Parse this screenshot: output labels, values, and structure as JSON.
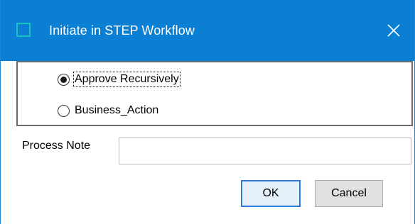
{
  "window": {
    "title": "Initiate in STEP Workflow",
    "title_bar_color": "#0b7fd4",
    "app_icon": "window-square-icon",
    "close_icon": "close-x-icon"
  },
  "radio_group": {
    "options": [
      {
        "label": "Approve Recursively",
        "selected": true
      },
      {
        "label": "Business_Action",
        "selected": false
      }
    ]
  },
  "process_note": {
    "label": "Process Note",
    "value": ""
  },
  "buttons": {
    "ok_label": "OK",
    "cancel_label": "Cancel"
  }
}
